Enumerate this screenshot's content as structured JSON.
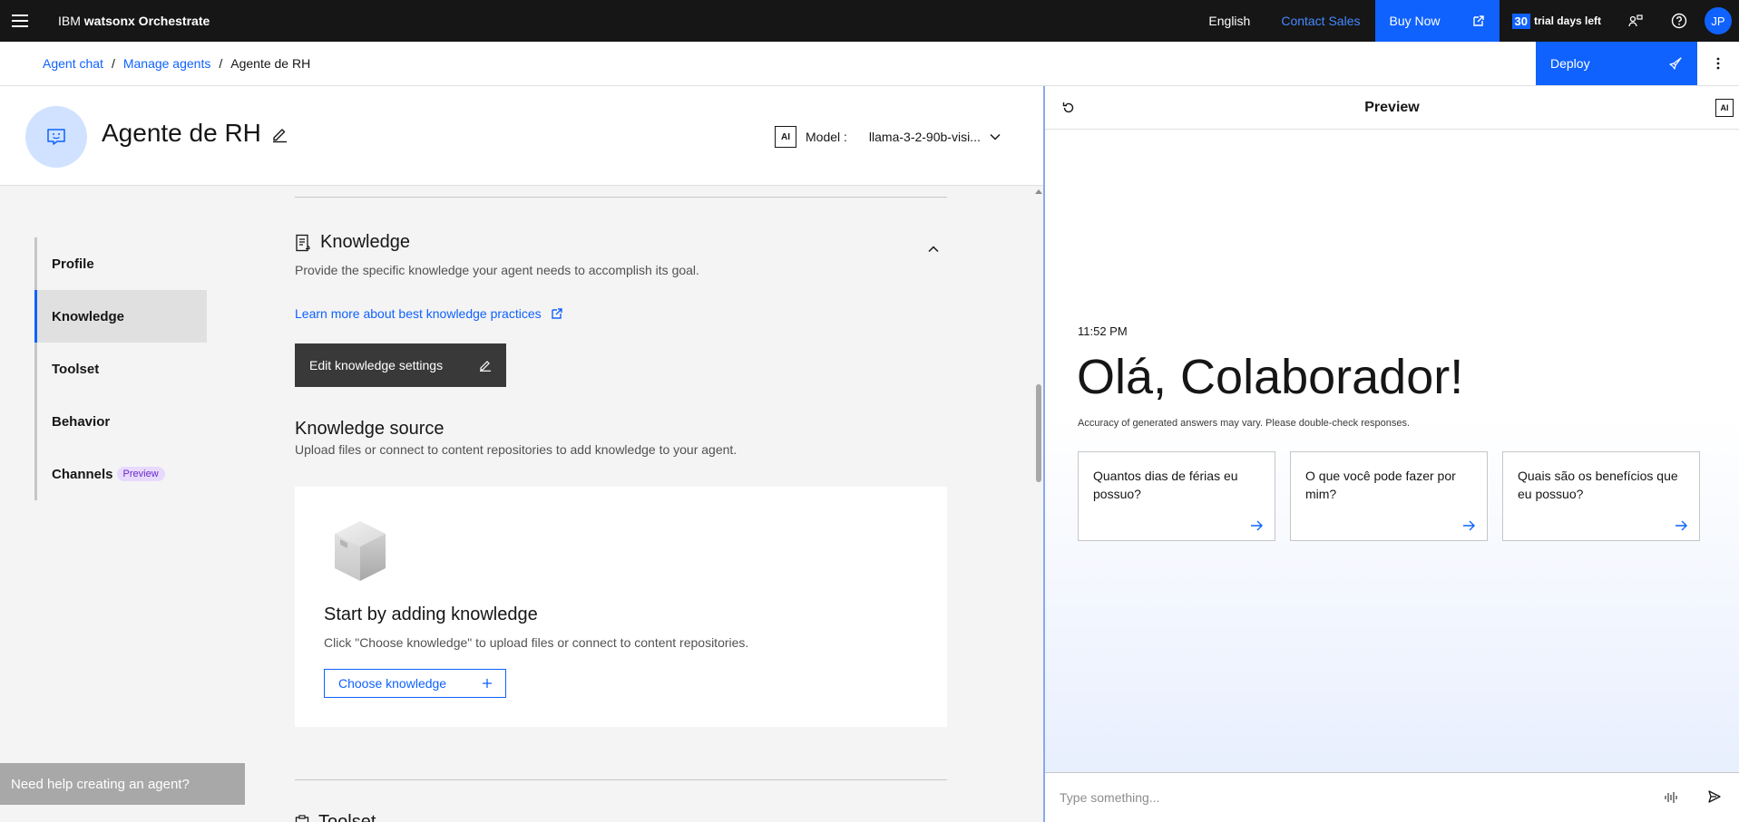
{
  "topbar": {
    "brand_prefix": "IBM",
    "brand_name": "watsonx Orchestrate",
    "language": "English",
    "contact_sales": "Contact Sales",
    "buy_now": "Buy Now",
    "trial_days": "30",
    "trial_text": "trial days left",
    "avatar_initials": "JP"
  },
  "breadcrumb": {
    "items": [
      "Agent chat",
      "Manage agents",
      "Agente de RH"
    ],
    "separator": "/"
  },
  "deploy_label": "Deploy",
  "agent": {
    "name": "Agente de RH",
    "model_badge": "AI",
    "model_label": "Model :",
    "model_value": "llama-3-2-90b-visi..."
  },
  "sidenav": {
    "items": [
      {
        "label": "Profile"
      },
      {
        "label": "Knowledge",
        "active": true
      },
      {
        "label": "Toolset"
      },
      {
        "label": "Behavior"
      },
      {
        "label": "Channels",
        "tag": "Preview"
      }
    ]
  },
  "knowledge": {
    "title": "Knowledge",
    "description": "Provide the specific knowledge your agent needs to accomplish its goal.",
    "learn_more": "Learn more about best knowledge practices",
    "edit_button": "Edit knowledge settings",
    "source_title": "Knowledge source",
    "source_description": "Upload files or connect to content repositories to add knowledge to your agent.",
    "empty_title": "Start by adding knowledge",
    "empty_description": "Click \"Choose knowledge\" to upload files or connect to content repositories.",
    "choose_button": "Choose knowledge",
    "next_section_title": "Toolset"
  },
  "help_pill": "Need help creating an agent?",
  "preview": {
    "title": "Preview",
    "ai_badge": "AI",
    "time": "11:52 PM",
    "greeting": "Olá, Colaborador!",
    "disclaimer": "Accuracy of generated answers may vary. Please double-check responses.",
    "suggestions": [
      "Quantos dias de férias eu possuo?",
      "O que você pode fazer por mim?",
      "Quais são os benefícios que eu possuo?"
    ],
    "input_placeholder": "Type something..."
  },
  "colors": {
    "accent": "#0f62fe",
    "topbar_bg": "#161616",
    "active_nav_bg": "#e0e0e0",
    "preview_tag_bg": "#e8daff"
  }
}
